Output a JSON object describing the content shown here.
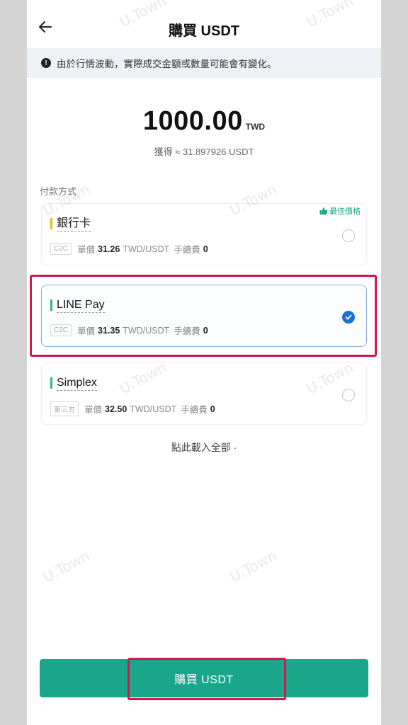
{
  "header": {
    "title": "購買 USDT"
  },
  "notice": {
    "icon": "exclamation-icon",
    "text": "由於行情波動，實際成交金額或數量可能會有變化。"
  },
  "order": {
    "amount": "1000.00",
    "currency": "TWD",
    "receive_text": "獲得 ≈ 31.897926 USDT"
  },
  "payment": {
    "section_label": "付款方式",
    "best_badge": "最佳價格",
    "methods": [
      {
        "name": "銀行卡",
        "tag": "C2C",
        "price_label": "單價",
        "price": "31.26",
        "unit": "TWD/USDT",
        "fee_label": "手續費",
        "fee": "0",
        "selected": false,
        "accent": "#f0b90b"
      },
      {
        "name": "LINE Pay",
        "tag": "C2C",
        "price_label": "單價",
        "price": "31.35",
        "unit": "TWD/USDT",
        "fee_label": "手續費",
        "fee": "0",
        "selected": true,
        "accent": "#37b86d"
      },
      {
        "name": "Simplex",
        "tag": "第三方",
        "price_label": "單價",
        "price": "32.50",
        "unit": "TWD/USDT",
        "fee_label": "手續費",
        "fee": "0",
        "selected": false,
        "accent": "#37b86d"
      }
    ],
    "load_all": "點此載入全部 ·"
  },
  "footer": {
    "buy_label": "購買 USDT"
  },
  "watermark": "U.Town",
  "colors": {
    "primary": "#1aa68a",
    "highlight": "#d4184c",
    "check": "#1e6fd8"
  }
}
